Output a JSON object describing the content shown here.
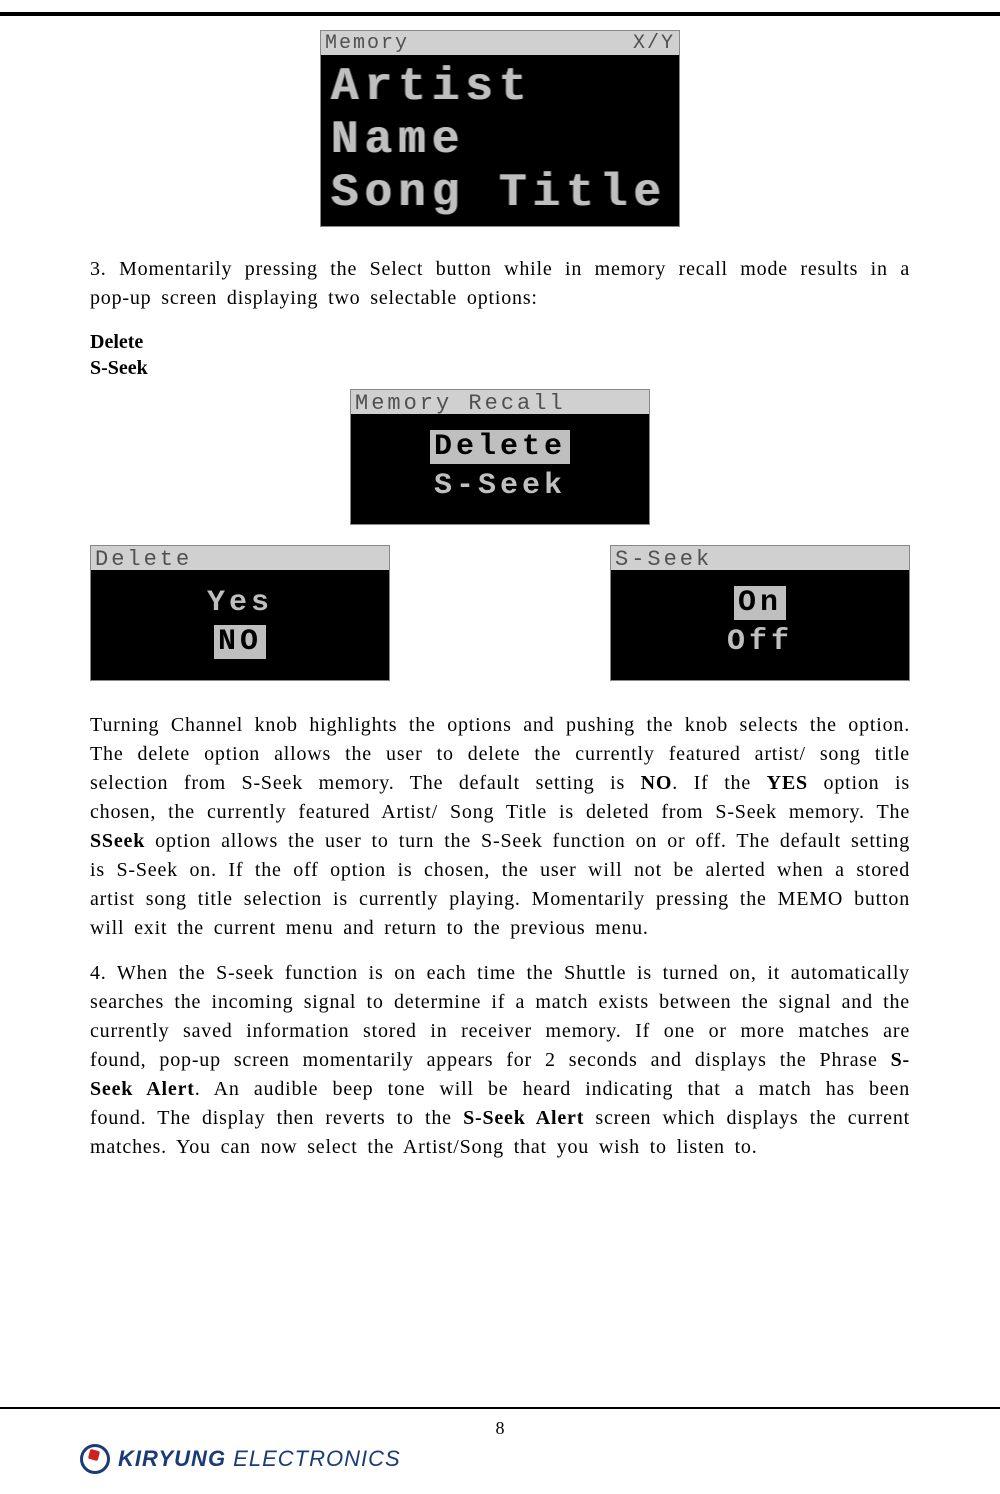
{
  "screen_memory": {
    "title_left": "Memory",
    "title_right": "X/Y",
    "line1": "Artist Name",
    "line2": "Song Title"
  },
  "para3_lead": "3. Momentarily pressing the Select button while in memory recall mode results in a pop-up screen displaying two selectable options:",
  "options": {
    "a": "Delete",
    "b": "S-Seek"
  },
  "screen_recall": {
    "title": "Memory Recall",
    "opt1": "Delete",
    "opt2": "S-Seek"
  },
  "screen_delete": {
    "title": "Delete",
    "opt1": "Yes",
    "opt2": "NO"
  },
  "screen_sseek": {
    "title": "S-Seek",
    "opt1": "On",
    "opt2": "Off"
  },
  "para_channel_1": "Turning Channel knob highlights the options and pushing the knob selects the option. The delete option allows the user to delete the currently featured artist/ song title selection from S-Seek memory. The default setting is ",
  "para_channel_b1": "NO",
  "para_channel_2": ". If the ",
  "para_channel_b2": "YES",
  "para_channel_3": " option is chosen, the currently featured Artist/ Song Title is deleted from S-Seek memory. The ",
  "para_channel_b3": "SSeek",
  "para_channel_4": " option allows the user to turn the S-Seek function on or off. The default setting is S-Seek on. If the off option is chosen, the user will not be alerted when a stored artist song title selection is currently playing. Momentarily pressing the MEMO button will exit the current menu and return to the previous menu.",
  "para4_1": "4. When the S-seek function is on each time the Shuttle is turned on, it automatically searches the incoming signal to determine if a match exists between the signal and the currently saved information stored in receiver memory. If one or more matches are found, pop-up screen momentarily appears for 2 seconds and displays the Phrase ",
  "para4_b1": "S-Seek Alert",
  "para4_2": ". An audible beep tone will be heard indicating that a match has been found. The display then reverts to the ",
  "para4_b2": "S-Seek Alert",
  "para4_3": " screen which displays the current matches. You can now select the Artist/Song that you wish to listen to.",
  "pagenum": "8",
  "footer": {
    "brand1": "KIRYUNG",
    "brand2": " ELECTRONICS"
  }
}
